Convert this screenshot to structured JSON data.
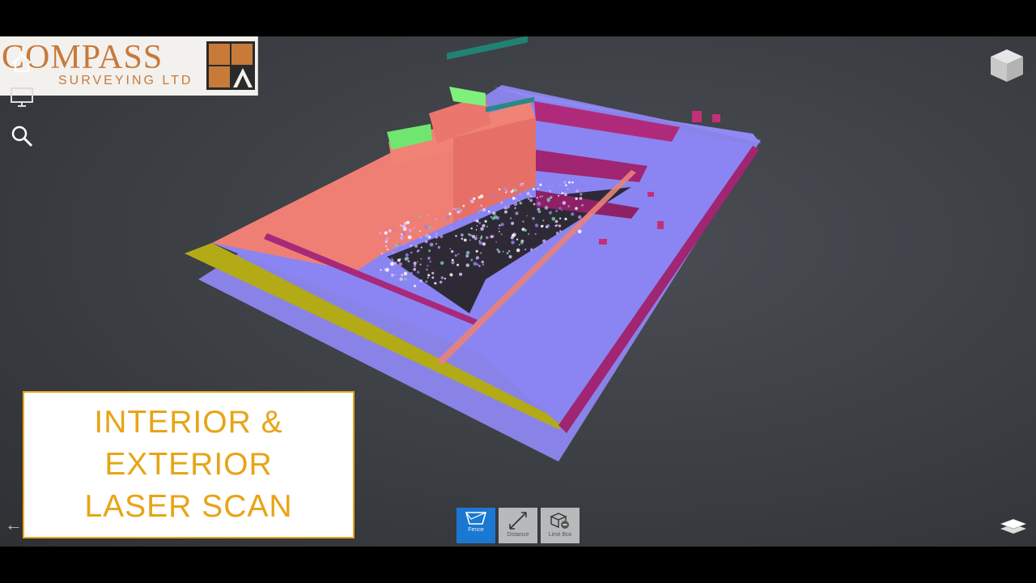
{
  "logo": {
    "company": "COMPASS",
    "subtitle": "SURVEYING LTD"
  },
  "sidebar": {
    "icons": [
      "home-icon",
      "monitor-icon",
      "search-icon"
    ]
  },
  "caption": {
    "line1": "INTERIOR &",
    "line2": "EXTERIOR",
    "line3": "LASER SCAN"
  },
  "toolbar": {
    "tools": [
      {
        "label": "Fence",
        "active": true
      },
      {
        "label": "Distance",
        "active": false
      },
      {
        "label": "Limit Box",
        "active": false
      }
    ]
  },
  "colors": {
    "roof": "#8c86f2",
    "walls": "#ef8078",
    "accent_green": "#7ef07a",
    "deck_edge": "#b6ad16",
    "magenta": "#b0287a",
    "caption_text": "#e8a416",
    "tool_active": "#1a78d2"
  }
}
